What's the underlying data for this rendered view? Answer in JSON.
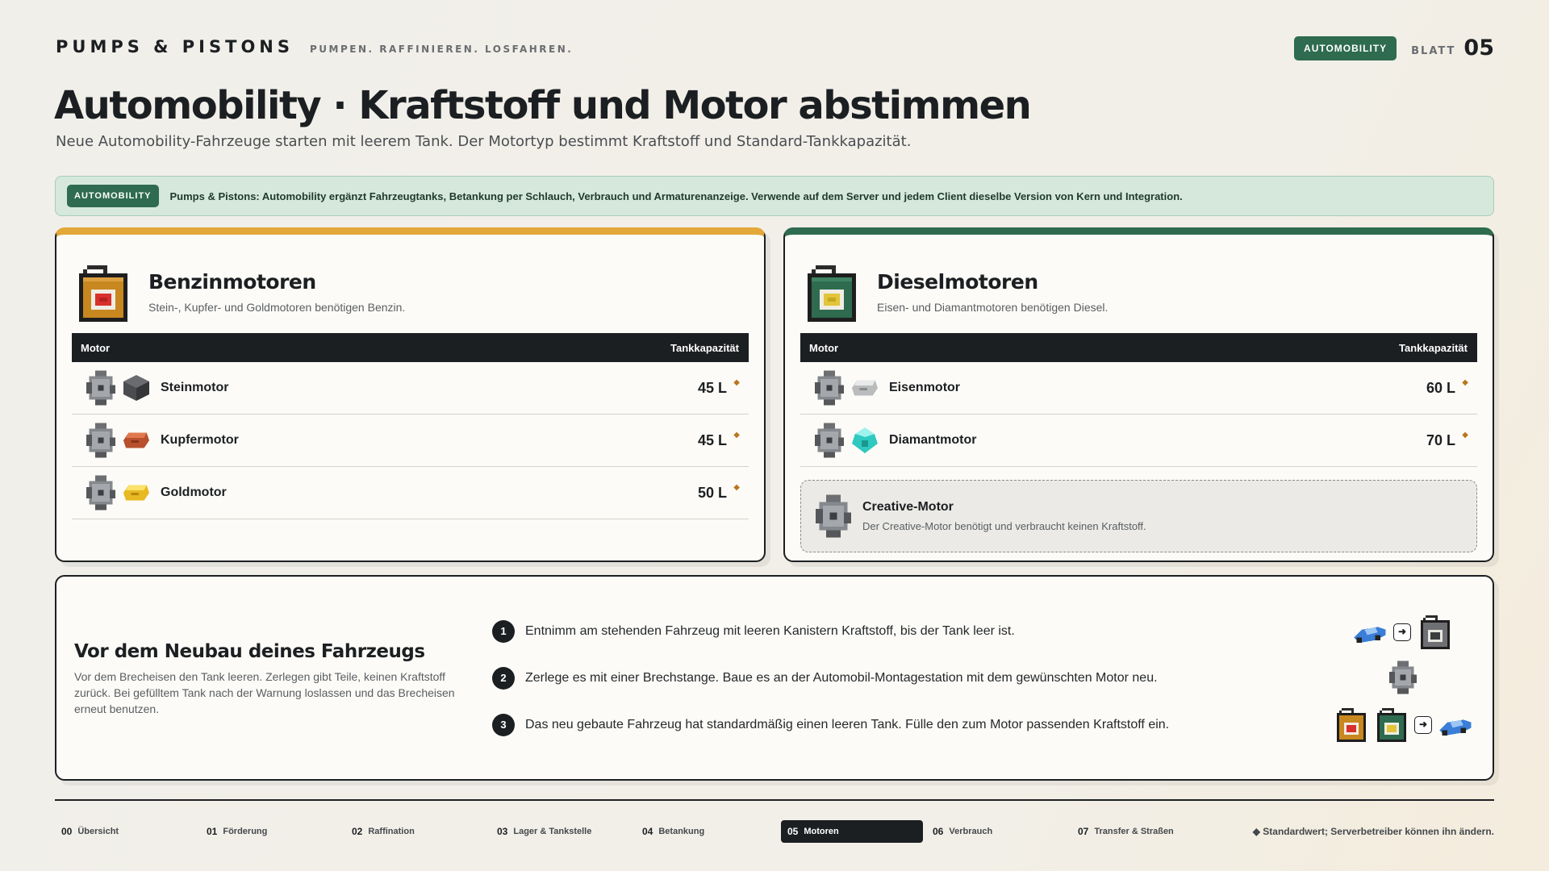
{
  "header": {
    "brand": "PUMPS & PISTONS",
    "tagline": "PUMPEN. RAFFINIEREN. LOSFAHREN.",
    "badge": "AUTOMOBILITY",
    "sheet_label": "BLATT",
    "sheet_number": "05"
  },
  "title": "Automobility · Kraftstoff und Motor abstimmen",
  "subtitle": "Neue Automobility-Fahrzeuge starten mit leerem Tank. Der Motortyp bestimmt Kraftstoff und Standard-Tankkapazität.",
  "banner": {
    "badge": "AUTOMOBILITY",
    "text": "Pumps & Pistons: Automobility ergänzt Fahrzeugtanks, Betankung per Schlauch, Verbrauch und Armaturenanzeige. Verwende auf dem Server und jedem Client dieselbe Version von Kern und Integration."
  },
  "gasoline": {
    "title": "Benzinmotoren",
    "description": "Stein-, Kupfer- und Goldmotoren benötigen Benzin.",
    "can_color": "#c8871f",
    "col_engine": "Motor",
    "col_capacity": "Tankkapazität",
    "rows": [
      {
        "name": "Steinmotor",
        "capacity": "45 L",
        "material": "stone-block-icon"
      },
      {
        "name": "Kupfermotor",
        "capacity": "45 L",
        "material": "copper-ingot-icon"
      },
      {
        "name": "Goldmotor",
        "capacity": "50 L",
        "material": "gold-ingot-icon"
      }
    ]
  },
  "diesel": {
    "title": "Dieselmotoren",
    "description": "Eisen- und Diamantmotoren benötigen Diesel.",
    "can_color": "#2e6b4f",
    "col_engine": "Motor",
    "col_capacity": "Tankkapazität",
    "rows": [
      {
        "name": "Eisenmotor",
        "capacity": "60 L",
        "material": "iron-ingot-icon"
      },
      {
        "name": "Diamantmotor",
        "capacity": "70 L",
        "material": "diamond-icon"
      }
    ],
    "creative": {
      "title": "Creative-Motor",
      "description": "Der Creative-Motor benötigt und verbraucht keinen Kraftstoff."
    }
  },
  "default_marker": "◆",
  "rebuild": {
    "title": "Vor dem Neubau deines Fahrzeugs",
    "description": "Vor dem Brecheisen den Tank leeren. Zerlegen gibt Teile, keinen Kraftstoff zurück. Bei gefülltem Tank nach der Warnung loslassen und das Brecheisen erneut benutzen.",
    "steps": [
      {
        "num": "1",
        "text": "Entnimm am stehenden Fahrzeug mit leeren Kanistern Kraftstoff, bis der Tank leer ist."
      },
      {
        "num": "2",
        "text": "Zerlege es mit einer Brechstange. Baue es an der Automobil-Montagestation mit dem gewünschten Motor neu."
      },
      {
        "num": "3",
        "text": "Das neu gebaute Fahrzeug hat standardmäßig einen leeren Tank. Fülle den zum Motor passenden Kraftstoff ein."
      }
    ],
    "arrow_glyph": "➜"
  },
  "nav": {
    "items": [
      {
        "num": "00",
        "label": "Übersicht"
      },
      {
        "num": "01",
        "label": "Förderung"
      },
      {
        "num": "02",
        "label": "Raffination"
      },
      {
        "num": "03",
        "label": "Lager & Tankstelle"
      },
      {
        "num": "04",
        "label": "Betankung"
      },
      {
        "num": "05",
        "label": "Motoren",
        "active": true
      },
      {
        "num": "06",
        "label": "Verbrauch"
      },
      {
        "num": "07",
        "label": "Transfer & Straßen"
      }
    ],
    "legend": "◆ Standardwert; Serverbetreiber können ihn ändern."
  },
  "colors": {
    "accent_green": "#2e6b4f",
    "accent_gold": "#e3a83a",
    "ink": "#1c1f22"
  }
}
